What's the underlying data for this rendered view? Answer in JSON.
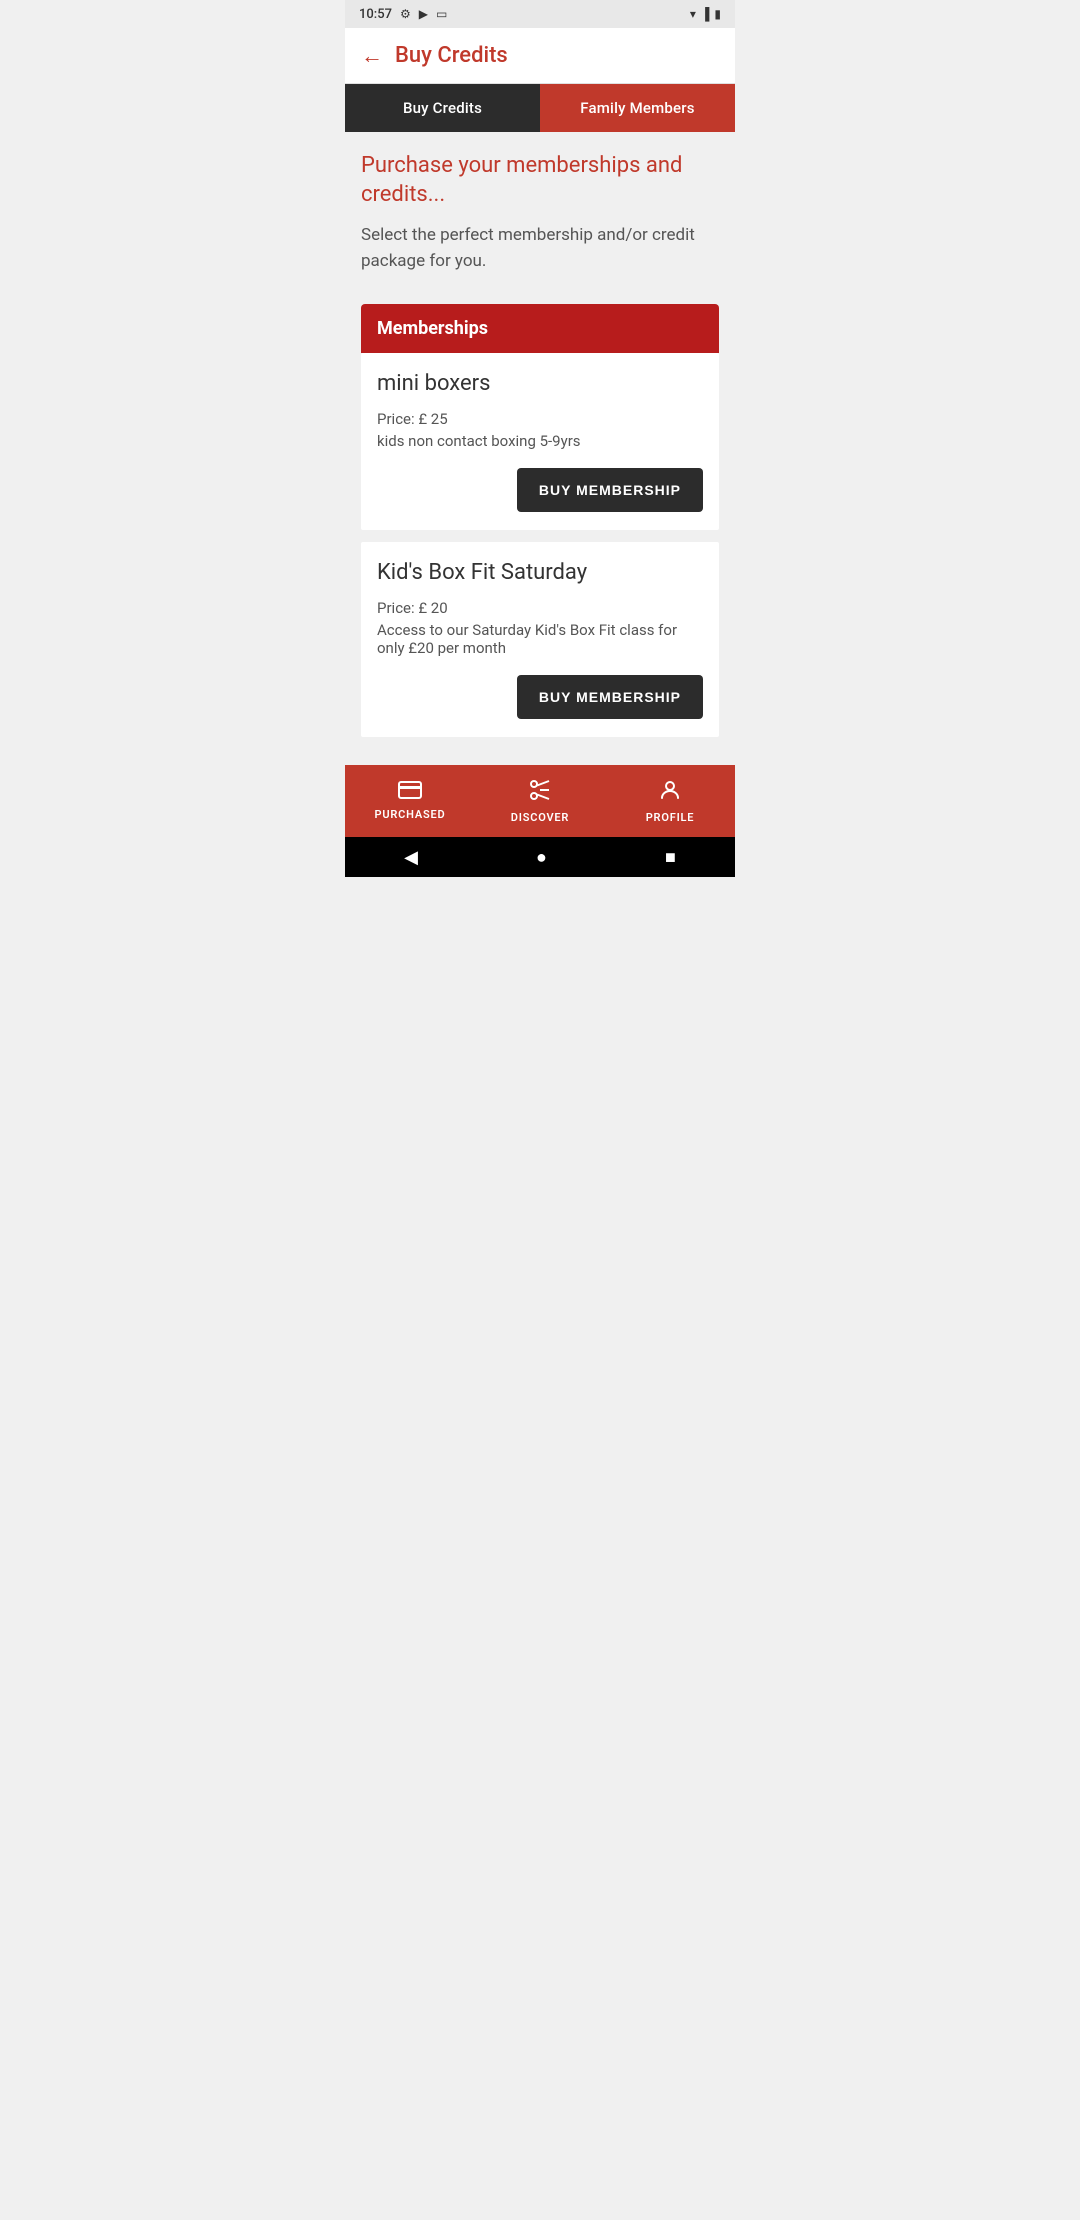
{
  "statusBar": {
    "time": "10:57",
    "icons": [
      "settings",
      "play",
      "sim"
    ]
  },
  "topBar": {
    "backLabel": "←",
    "title": "Buy Credits"
  },
  "tabs": [
    {
      "id": "buy-credits",
      "label": "Buy Credits",
      "active": true
    },
    {
      "id": "family-members",
      "label": "Family Members",
      "active": false
    }
  ],
  "content": {
    "heading": "Purchase your memberships and credits...",
    "subtext": "Select the perfect membership and/or credit package for you.",
    "membershipsHeader": "Memberships",
    "memberships": [
      {
        "name": "mini boxers",
        "price": "Price: £ 25",
        "description": "kids non contact boxing 5-9yrs",
        "buttonLabel": "BUY MEMBERSHIP"
      },
      {
        "name": "Kid's Box Fit Saturday",
        "price": "Price: £ 20",
        "description": "Access to our Saturday Kid's Box Fit class for only £20 per month",
        "buttonLabel": "BUY MEMBERSHIP"
      }
    ]
  },
  "bottomNav": [
    {
      "id": "purchased",
      "label": "PURCHASED",
      "icon": "💳"
    },
    {
      "id": "discover",
      "label": "DISCOVER",
      "icon": "✂"
    },
    {
      "id": "profile",
      "label": "PROFILE",
      "icon": "👤"
    }
  ],
  "androidNav": {
    "back": "◀",
    "home": "●",
    "recent": "■"
  }
}
